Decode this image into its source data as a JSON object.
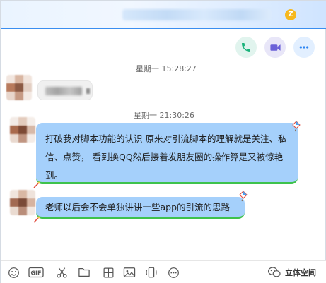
{
  "chat_window": {
    "title_badge": "Z",
    "accent_color": "#3a8ef0",
    "bubble_color": "#a5d0fb",
    "bubble_underline_color": "#3ec24c"
  },
  "actions": [
    {
      "name": "voice-call",
      "icon": "phone-icon",
      "color": "#19b27a"
    },
    {
      "name": "video-call",
      "icon": "video-camera-icon",
      "color": "#6b61d8"
    },
    {
      "name": "more",
      "icon": "more-dots-icon",
      "color": "#2e86f2"
    }
  ],
  "messages": {
    "timestamp_1": "星期一 15:28:27",
    "timestamp_2": "星期一 21:30:26",
    "bubble_1": "打破我对脚本功能的认识 原来对引流脚本的理解就是关注、私信、点赞， 看到换QQ然后接着发朋友圈的操作算是又被惊艳到。",
    "bubble_2": "老师以后会不会单独讲讲一些app的引流的思路"
  },
  "toolbar": {
    "gif_label": "GIF",
    "tools": [
      "emoji-icon",
      "gif-icon",
      "scissors-icon",
      "folder-icon",
      "image-grid-icon",
      "image-icon",
      "phone-shake-icon",
      "more-icon"
    ]
  },
  "watermark": {
    "text": "立体空间",
    "icon": "wechat-official-account-icon"
  }
}
